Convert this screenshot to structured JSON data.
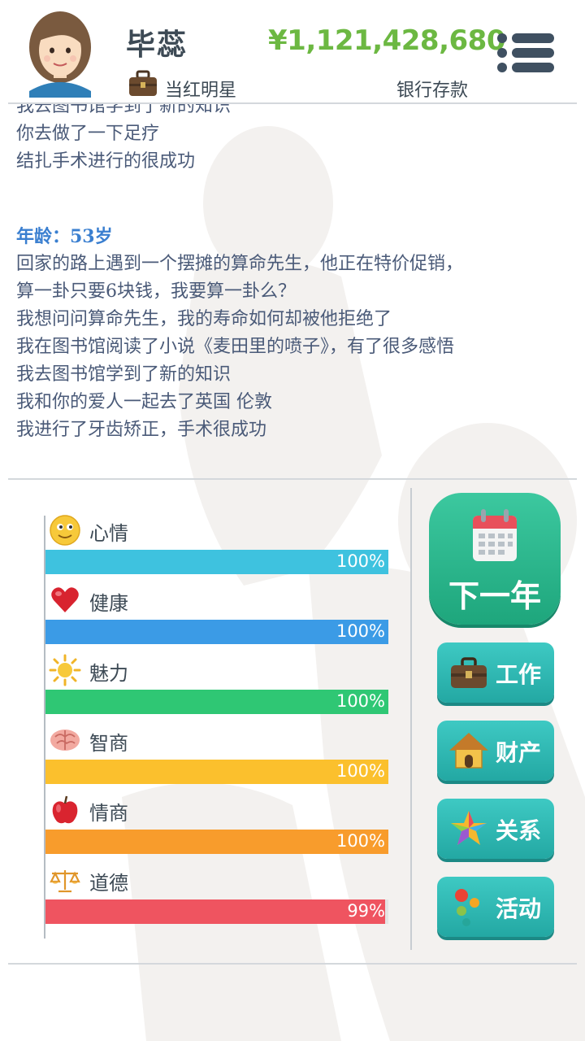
{
  "header": {
    "player_name": "毕蕊",
    "job_title": "当红明星",
    "money": "¥1,121,428,680",
    "money_label": "银行存款"
  },
  "log": {
    "lines_before": [
      "我去图书馆学到了新的知识",
      "你去做了一下足疗",
      "结扎手术进行的很成功"
    ],
    "age_label": "年龄：53岁",
    "lines_after": [
      "回家的路上遇到一个摆摊的算命先生，他正在特价促销，",
      "算一卦只要6块钱，我要算一卦么？",
      "我想问问算命先生，我的寿命如何却被他拒绝了",
      "我在图书馆阅读了小说《麦田里的喷子》，有了很多感悟",
      "我去图书馆学到了新的知识",
      "我和你的爱人一起去了英国 伦敦",
      "我进行了牙齿矫正，手术很成功"
    ]
  },
  "stats": [
    {
      "label": "心情",
      "percent_text": "100%",
      "value": 100,
      "color": "#3ec2df",
      "icon": "smiley-icon"
    },
    {
      "label": "健康",
      "percent_text": "100%",
      "value": 100,
      "color": "#3b9be6",
      "icon": "heart-icon"
    },
    {
      "label": "魅力",
      "percent_text": "100%",
      "value": 100,
      "color": "#2fc774",
      "icon": "sun-icon"
    },
    {
      "label": "智商",
      "percent_text": "100%",
      "value": 100,
      "color": "#fbc02d",
      "icon": "brain-icon"
    },
    {
      "label": "情商",
      "percent_text": "100%",
      "value": 100,
      "color": "#f89c2c",
      "icon": "apple-icon"
    },
    {
      "label": "道德",
      "percent_text": "99%",
      "value": 99,
      "color": "#ef5460",
      "icon": "scales-icon"
    }
  ],
  "actions": {
    "next_year": "下一年",
    "work": "工作",
    "property": "财产",
    "relations": "关系",
    "activities": "活动"
  },
  "colors": {
    "money": "#6cb842",
    "age": "#3a7fd0",
    "log_text": "#4a5a78",
    "next_year_bg": "#2cb98e",
    "action_bg": "#34b9b4"
  }
}
